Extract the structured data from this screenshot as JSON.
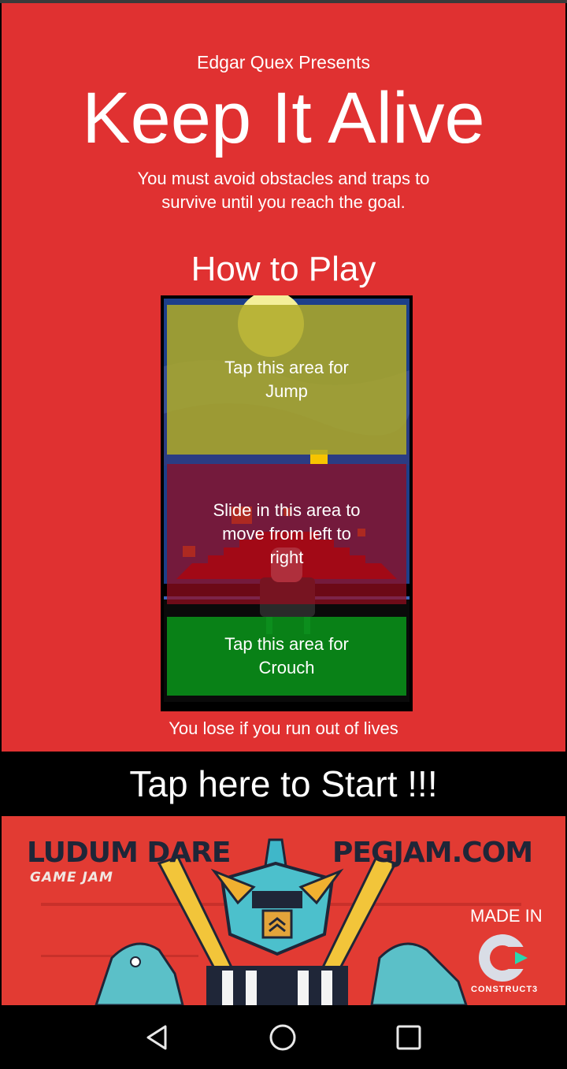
{
  "header": {
    "presents": "Edgar Quex Presents",
    "title": "Keep It Alive",
    "subtitle": "You must avoid obstacles and traps to survive until you reach the goal."
  },
  "tutorial": {
    "heading": "How to Play",
    "jump_zone": "Tap this area for Jump",
    "move_zone": "Slide in this area to move from left to right",
    "crouch_zone": "Tap this area for Crouch",
    "lose_note": "You lose if you run out of lives"
  },
  "start_button": {
    "label": "Tap here to Start !!!"
  },
  "banner": {
    "ludum_title": "LUDUM DARE",
    "ludum_sub": "GAME JAM",
    "pegjam": "PEGJAM.COM",
    "made_in": "MADE IN",
    "construct": "CONSTRUCT3"
  },
  "nav": {
    "back_icon": "back-triangle-icon",
    "home_icon": "home-circle-icon",
    "recents_icon": "recents-square-icon"
  },
  "colors": {
    "background": "#e03131",
    "start_bar": "#000000",
    "jump_zone": "#afaa28",
    "move_zone": "#960c1e",
    "crouch_zone": "#0a8c19"
  }
}
